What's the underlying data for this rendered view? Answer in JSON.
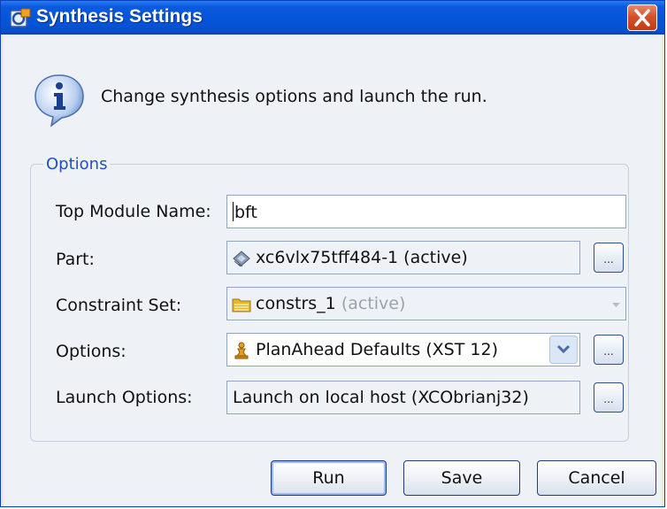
{
  "window": {
    "title": "Synthesis Settings"
  },
  "intro": {
    "text": "Change synthesis options and launch the run."
  },
  "options": {
    "legend": "Options",
    "top_module": {
      "label": "Top Module Name:",
      "value": "bft"
    },
    "part": {
      "label": "Part:",
      "value": "xc6vlx75tff484-1 (active)"
    },
    "constraint_set": {
      "label": "Constraint Set:",
      "name": "constrs_1",
      "status": "(active)"
    },
    "strategy": {
      "label": "Options:",
      "value": "PlanAhead Defaults (XST 12)"
    },
    "launch": {
      "label": "Launch Options:",
      "value": "Launch on local host (XCObrianj32)"
    },
    "browse_label": "..."
  },
  "buttons": {
    "run": "Run",
    "save": "Save",
    "cancel": "Cancel"
  },
  "colors": {
    "title_bar": "#0553d8",
    "close": "#d6512c",
    "legend": "#1f4fc4",
    "client": "#eef2f7"
  }
}
